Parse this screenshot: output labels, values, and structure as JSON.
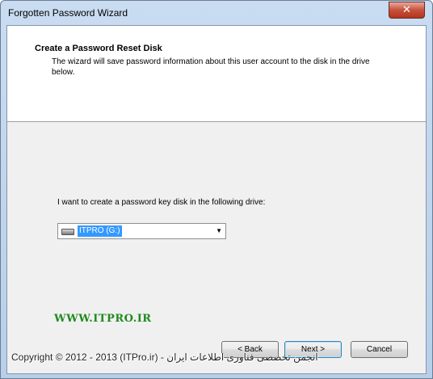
{
  "window": {
    "title": "Forgotten Password Wizard",
    "close_glyph": "✕"
  },
  "header": {
    "title": "Create a Password Reset Disk",
    "description": "The wizard will save password information about this user account to the disk in the drive below."
  },
  "drive": {
    "prompt": "I want to create a password key disk in the following drive:",
    "selected": "ITPRO (G:)",
    "dropdown_glyph": "▼",
    "icon": "drive-icon"
  },
  "buttons": {
    "back": "< Back",
    "next": "Next >",
    "cancel": "Cancel"
  },
  "watermarks": {
    "site": "WWW.ITPRO.IR",
    "footer": "Copyright © 2012 - 2013 (ITPro.ir) - انجمن تخصصی فناوری اطلاعات ایران"
  },
  "colors": {
    "selection": "#3399ff",
    "watermark_green": "#1f8a1f",
    "close_red": "#c7503a"
  }
}
